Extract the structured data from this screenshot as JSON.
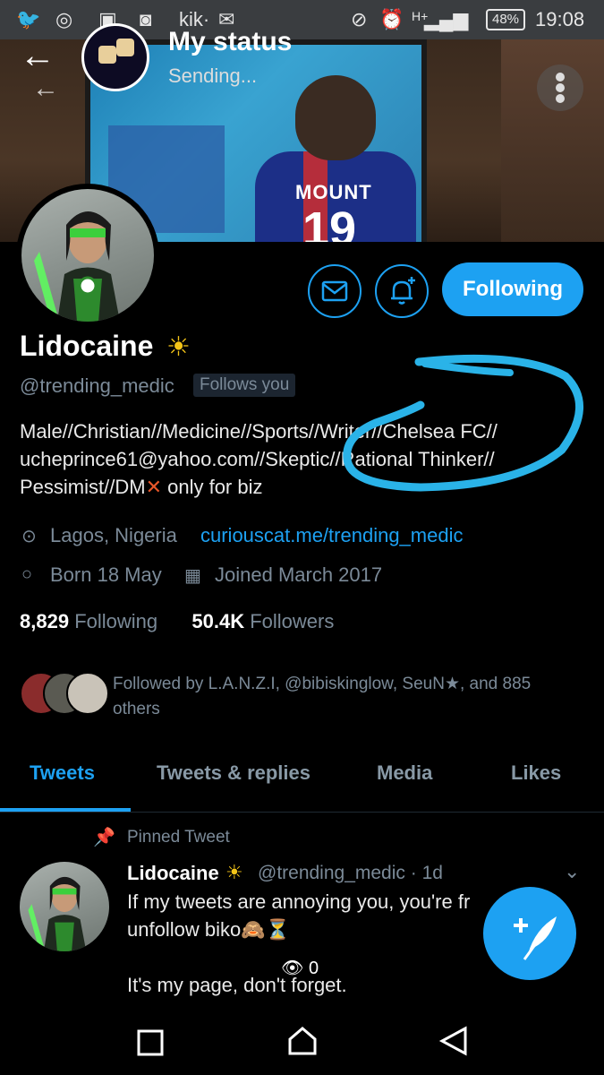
{
  "status_bar": {
    "left_icons": [
      "twitter-icon",
      "whatsapp-icon",
      "youtube-icon",
      "instagram-icon"
    ],
    "kik": "kik·",
    "network": "H+",
    "battery": "48%",
    "time": "19:08"
  },
  "status_header": {
    "title": "My status",
    "subtitle": "Sending..."
  },
  "banner": {
    "shirt_name": "MOUNT",
    "shirt_number": "19"
  },
  "profile": {
    "display_name": "Lidocaine",
    "name_emoji": "☀",
    "handle": "@trending_medic",
    "follows_you_badge": "Follows you",
    "follow_button": "Following",
    "bio_line1": "Male//Christian//Medicine//Sports//Writer//Chelsea FC//",
    "bio_line2": "ucheprince61@yahoo.com//Skeptic//Rational Thinker//",
    "bio_line3_a": "Pessimist//DM",
    "bio_line3_emoji": "✕",
    "bio_line3_b": " only for biz",
    "location": "Lagos, Nigeria",
    "website": "curiouscat.me/trending_medic",
    "birthday": "Born 18 May",
    "joined": "Joined March 2017",
    "following_count": "8,829",
    "following_label": "Following",
    "followers_count": "50.4K",
    "followers_label": "Followers",
    "followed_by": "Followed by L.A.N.Z.I, @bibiskinglow, SeuN★, and 885 others"
  },
  "tabs": [
    {
      "label": "Tweets",
      "active": true
    },
    {
      "label": "Tweets & replies",
      "active": false
    },
    {
      "label": "Media",
      "active": false
    },
    {
      "label": "Likes",
      "active": false
    }
  ],
  "pinned_tweet": {
    "pinned_label": "Pinned Tweet",
    "author": "Lidocaine",
    "author_emoji": "☀",
    "meta": "@trending_medic · 1d",
    "line1": "If my tweets are annoying you, you're fr",
    "line2": "unfollow biko🙈⏳",
    "line3": "It's my page, don't forget."
  },
  "views": "0",
  "colors": {
    "accent": "#1da1f2",
    "background": "#000000",
    "muted_text": "#7b8a98",
    "annotation_circle": "#2ab3e8"
  }
}
